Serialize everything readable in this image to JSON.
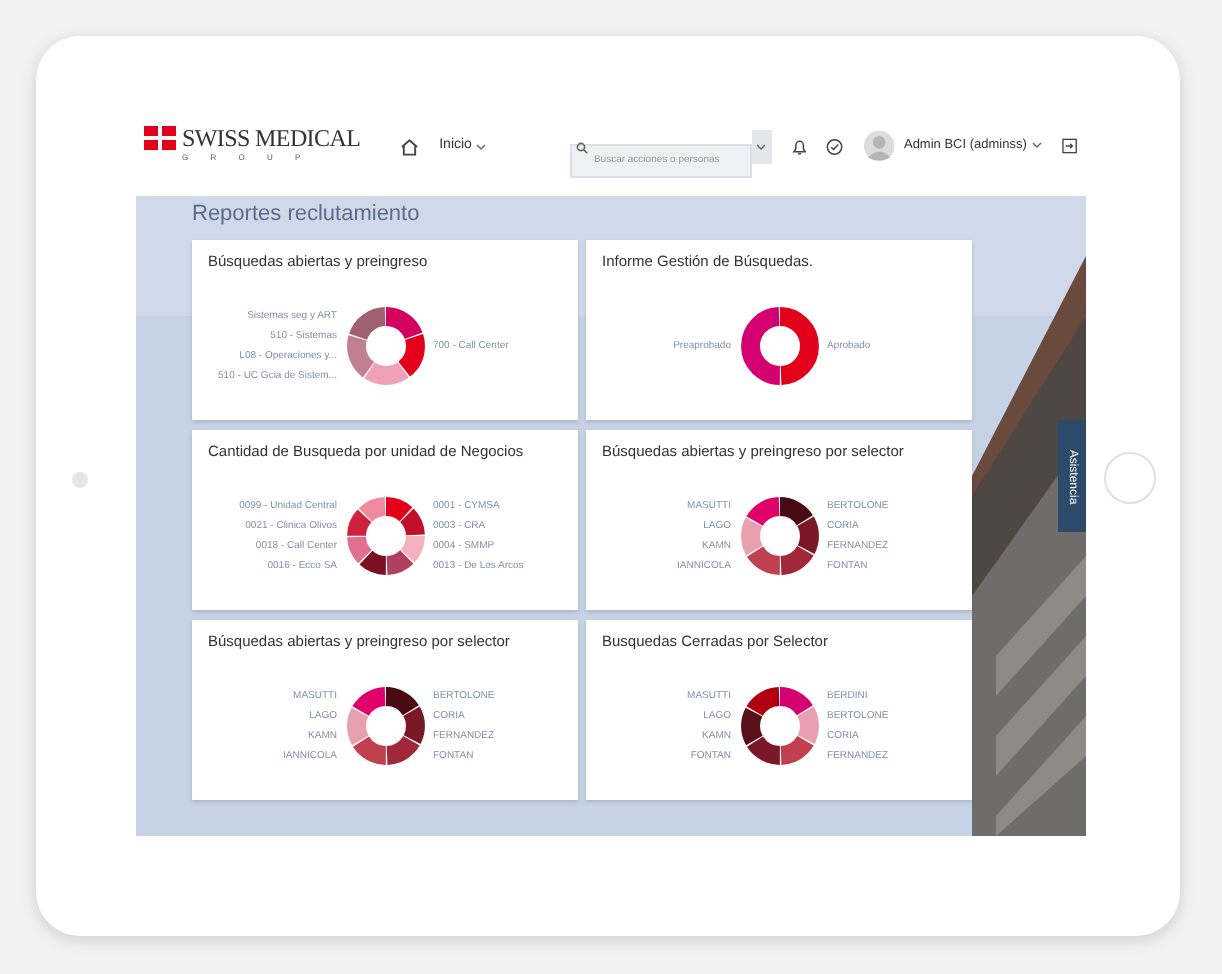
{
  "header": {
    "logo": {
      "name": "SWISS MEDICAL",
      "sub": "G R O U P"
    },
    "nav": "Inicio",
    "search": {
      "placeholder": "Buscar acciones o personas"
    },
    "user": "Admin BCI (adminss)"
  },
  "page_title": "Reportes reclutamiento",
  "cards": [
    {
      "title": "Búsquedas abiertas y preingreso",
      "labels_left": [
        "Sistemas seg y ART",
        "510 - Sistemas",
        "L08 - Operaciones y...",
        "510 - UC Gcia de Sistem..."
      ],
      "labels_right": [
        "700 - Call Center"
      ]
    },
    {
      "title": "Informe Gestión de Búsquedas.",
      "labels_left": [
        "Preaprobado"
      ],
      "labels_right": [
        "Aprobado"
      ]
    },
    {
      "title": "Cantidad de Busqueda por unidad de Negocios",
      "labels_left": [
        "0099 - Unidad Central",
        "0021 - Clinica Olivos",
        "0018 - Call Center",
        "0016 - Ecco SA"
      ],
      "labels_right": [
        "0001 - CYMSA",
        "0003 - CRA",
        "0004 - SMMP",
        "0013 - De Los Arcos"
      ]
    },
    {
      "title": "Búsquedas abiertas y preingreso por selector",
      "labels_left": [
        "MASUTTI",
        "LAGO",
        "KAMN",
        "IANNICOLA"
      ],
      "labels_right": [
        "BERTOLONE",
        "CORIA",
        "FERNANDEZ",
        "FONTAN"
      ]
    },
    {
      "title": "Búsquedas abiertas y preingreso por selector",
      "labels_left": [
        "MASUTTI",
        "LAGO",
        "KAMN",
        "IANNICOLA"
      ],
      "labels_right": [
        "BERTOLONE",
        "CORIA",
        "FERNANDEZ",
        "FONTAN"
      ]
    },
    {
      "title": "Busquedas Cerradas por Selector",
      "labels_left": [
        "MASUTTI",
        "LAGO",
        "KAMN",
        "FONTAN"
      ],
      "labels_right": [
        "BERDINI",
        "BERTOLONE",
        "CORIA",
        "FERNANDEZ"
      ]
    }
  ],
  "side_tab": "Asistencia"
}
